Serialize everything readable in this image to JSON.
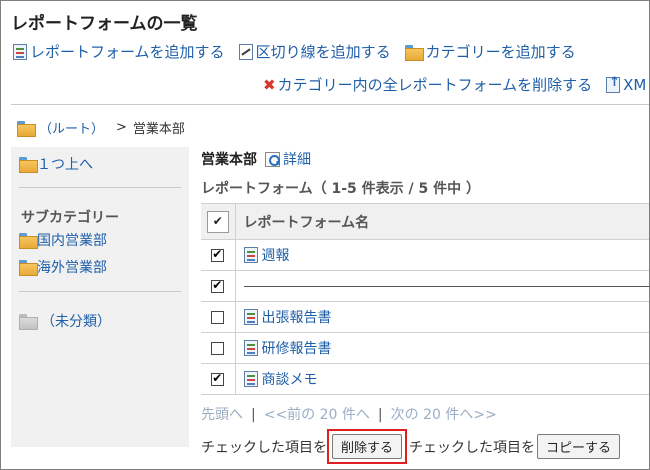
{
  "page": {
    "title": "レポートフォームの一覧"
  },
  "toolbar": {
    "add_form": "レポートフォームを追加する",
    "add_divider": "区切り線を追加する",
    "add_category": "カテゴリーを追加する",
    "delete_all_in_category": "カテゴリー内の全レポートフォームを削除する",
    "export": "XM"
  },
  "breadcrumb": {
    "root": "（ルート）",
    "separator": ">",
    "current": "営業本部"
  },
  "sidebar": {
    "up_link": "１つ上へ",
    "subcategory_heading": "サブカテゴリー",
    "subcategories": [
      "国内営業部",
      "海外営業部"
    ],
    "uncategorized": "（未分類）"
  },
  "content": {
    "category_name": "営業本部",
    "detail_link": "詳細",
    "subtitle": "レポートフォーム（ 1-5 件表示 / 5 件中 ）",
    "column_header": "レポートフォーム名",
    "rows": [
      {
        "type": "form",
        "name": "週報",
        "checked": true
      },
      {
        "type": "divider",
        "name": "",
        "checked": true
      },
      {
        "type": "form",
        "name": "出張報告書",
        "checked": false
      },
      {
        "type": "form",
        "name": "研修報告書",
        "checked": false
      },
      {
        "type": "form",
        "name": "商談メモ",
        "checked": true
      }
    ]
  },
  "pager": {
    "first": "先頭へ",
    "prev": "<<前の 20 件へ",
    "next": "次の 20 件へ>>",
    "separator": "|"
  },
  "actions": {
    "checked_items_label_1": "チェックした項目を",
    "delete_button": "削除する",
    "checked_items_label_2": "チェックした項目を",
    "copy_button": "コピーする"
  },
  "colors": {
    "link": "#1f5fa8",
    "highlight": "#e02020",
    "sidebar_bg": "#f1f1f1"
  }
}
